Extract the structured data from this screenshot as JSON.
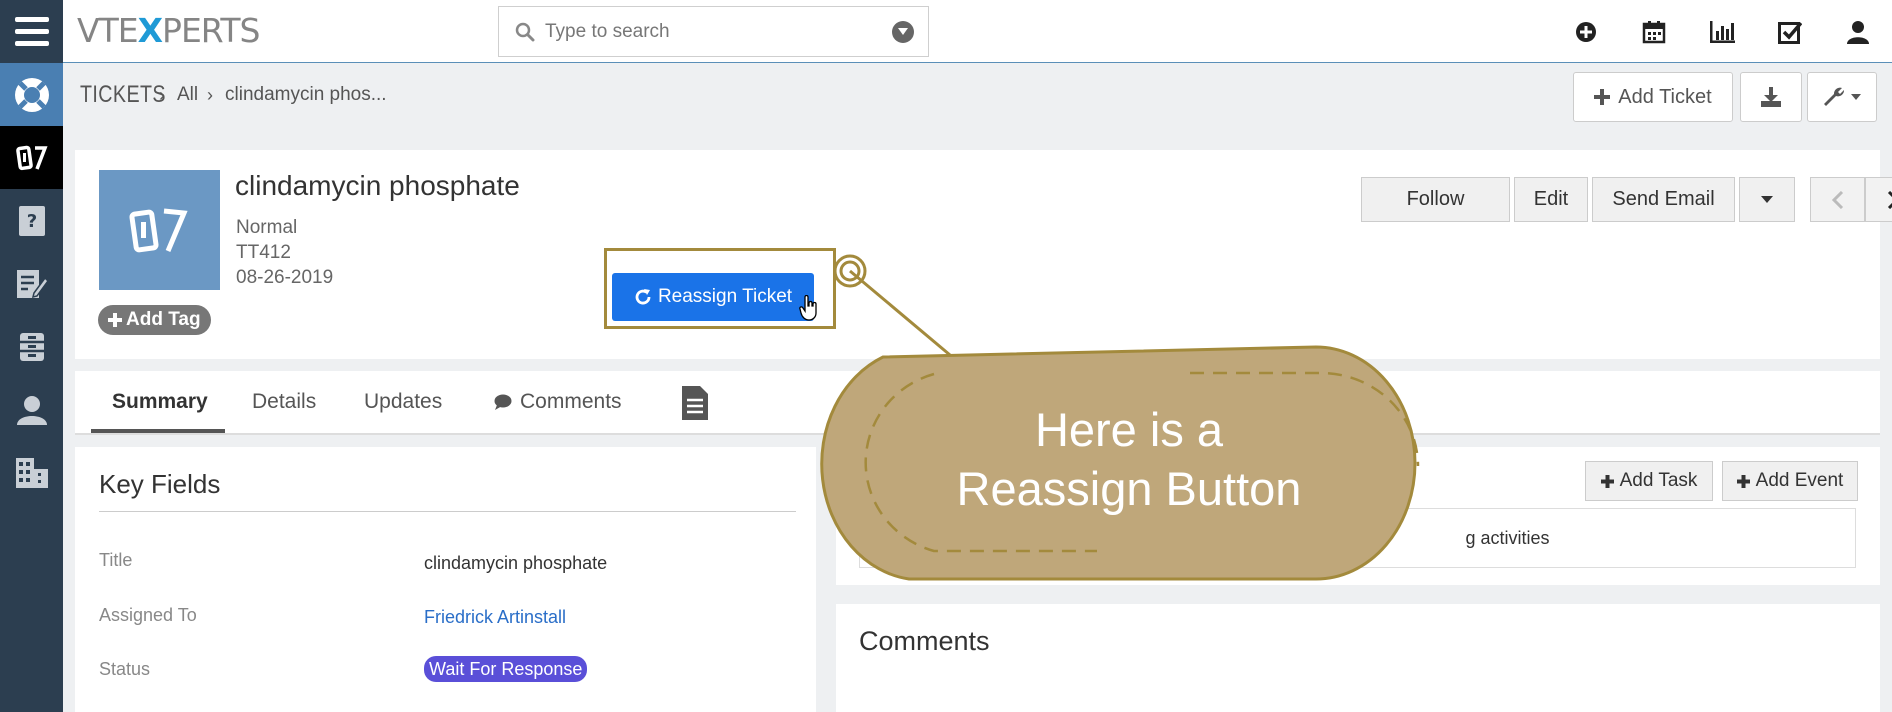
{
  "app": {
    "logo_left": "VTE",
    "logo_x": "X",
    "logo_right": "PERTS"
  },
  "search": {
    "placeholder": "Type to search"
  },
  "top_icons": [
    "plus-circle-icon",
    "calendar-icon",
    "chart-icon",
    "checkbox-icon",
    "user-icon"
  ],
  "rail": [
    "support-icon",
    "tickets-icon",
    "knowledge-icon",
    "notes-icon",
    "documents-icon",
    "contacts-icon",
    "organizations-icon"
  ],
  "breadcrumb": {
    "module": "TICKETS",
    "filter": "All",
    "record": "clindamycin phos..."
  },
  "header_buttons": {
    "add_ticket": "Add Ticket"
  },
  "record": {
    "name": "clindamycin phosphate",
    "priority": "Normal",
    "number": "TT412",
    "date": "08-26-2019",
    "add_tag": "Add Tag",
    "reassign": "Reassign Ticket",
    "follow": "Follow",
    "edit": "Edit",
    "send_email": "Send Email"
  },
  "tabs": [
    "Summary",
    "Details",
    "Updates",
    "Comments"
  ],
  "key_fields": {
    "title": "Key Fields",
    "rows": [
      {
        "label": "Title",
        "value": "clindamycin phosphate"
      },
      {
        "label": "Assigned To",
        "value": "Friedrick Artinstall"
      },
      {
        "label": "Status",
        "value": "Wait For Response"
      }
    ]
  },
  "activities": {
    "add_task": "Add Task",
    "add_event": "Add Event",
    "empty_fragment": "g activities"
  },
  "comments": {
    "title": "Comments"
  },
  "callout": {
    "line1": "Here is a",
    "line2": "Reassign Button"
  },
  "colors": {
    "rail": "#2c3e50",
    "primary": "#1a73e8",
    "callout": "#bfa77a",
    "callout_border": "#a38a3c",
    "status": "#5a4fd8"
  }
}
